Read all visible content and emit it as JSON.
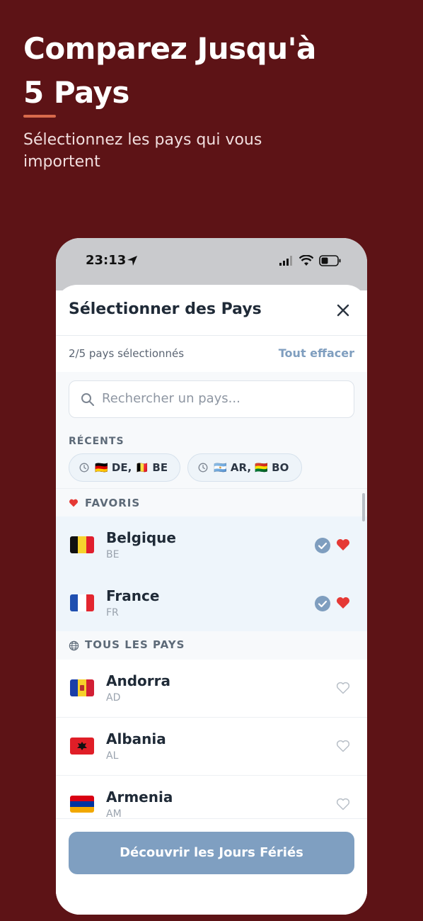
{
  "headline": {
    "title_line1": "Comparez Jusqu'à",
    "title_line2": "5 Pays",
    "subtitle": "Sélectionnez les pays qui vous importent"
  },
  "status_bar": {
    "time": "23:13"
  },
  "sheet": {
    "title": "Sélectionner des Pays",
    "selection_count": "2/5 pays sélectionnés",
    "clear_all": "Tout effacer",
    "search_placeholder": "Rechercher un pays..."
  },
  "recents": {
    "label": "RÉCENTS",
    "chips": [
      {
        "text": "🇩🇪 DE, 🇧🇪 BE"
      },
      {
        "text": "🇦🇷 AR, 🇧🇴 BO"
      }
    ]
  },
  "favorites": {
    "label": "FAVORIS",
    "items": [
      {
        "name": "Belgique",
        "code": "BE",
        "selected": true,
        "favorite": true
      },
      {
        "name": "France",
        "code": "FR",
        "selected": true,
        "favorite": true
      }
    ]
  },
  "all_countries": {
    "label": "TOUS LES PAYS",
    "items": [
      {
        "name": "Andorra",
        "code": "AD",
        "favorite": false
      },
      {
        "name": "Albania",
        "code": "AL",
        "favorite": false
      },
      {
        "name": "Armenia",
        "code": "AM",
        "favorite": false
      }
    ]
  },
  "footer": {
    "cta_label": "Découvrir les Jours Fériés"
  },
  "colors": {
    "background": "#5d1316",
    "accent": "#d86a4b",
    "link": "#7f9ebf",
    "cta": "#7f9fc1",
    "heart": "#e53935"
  }
}
